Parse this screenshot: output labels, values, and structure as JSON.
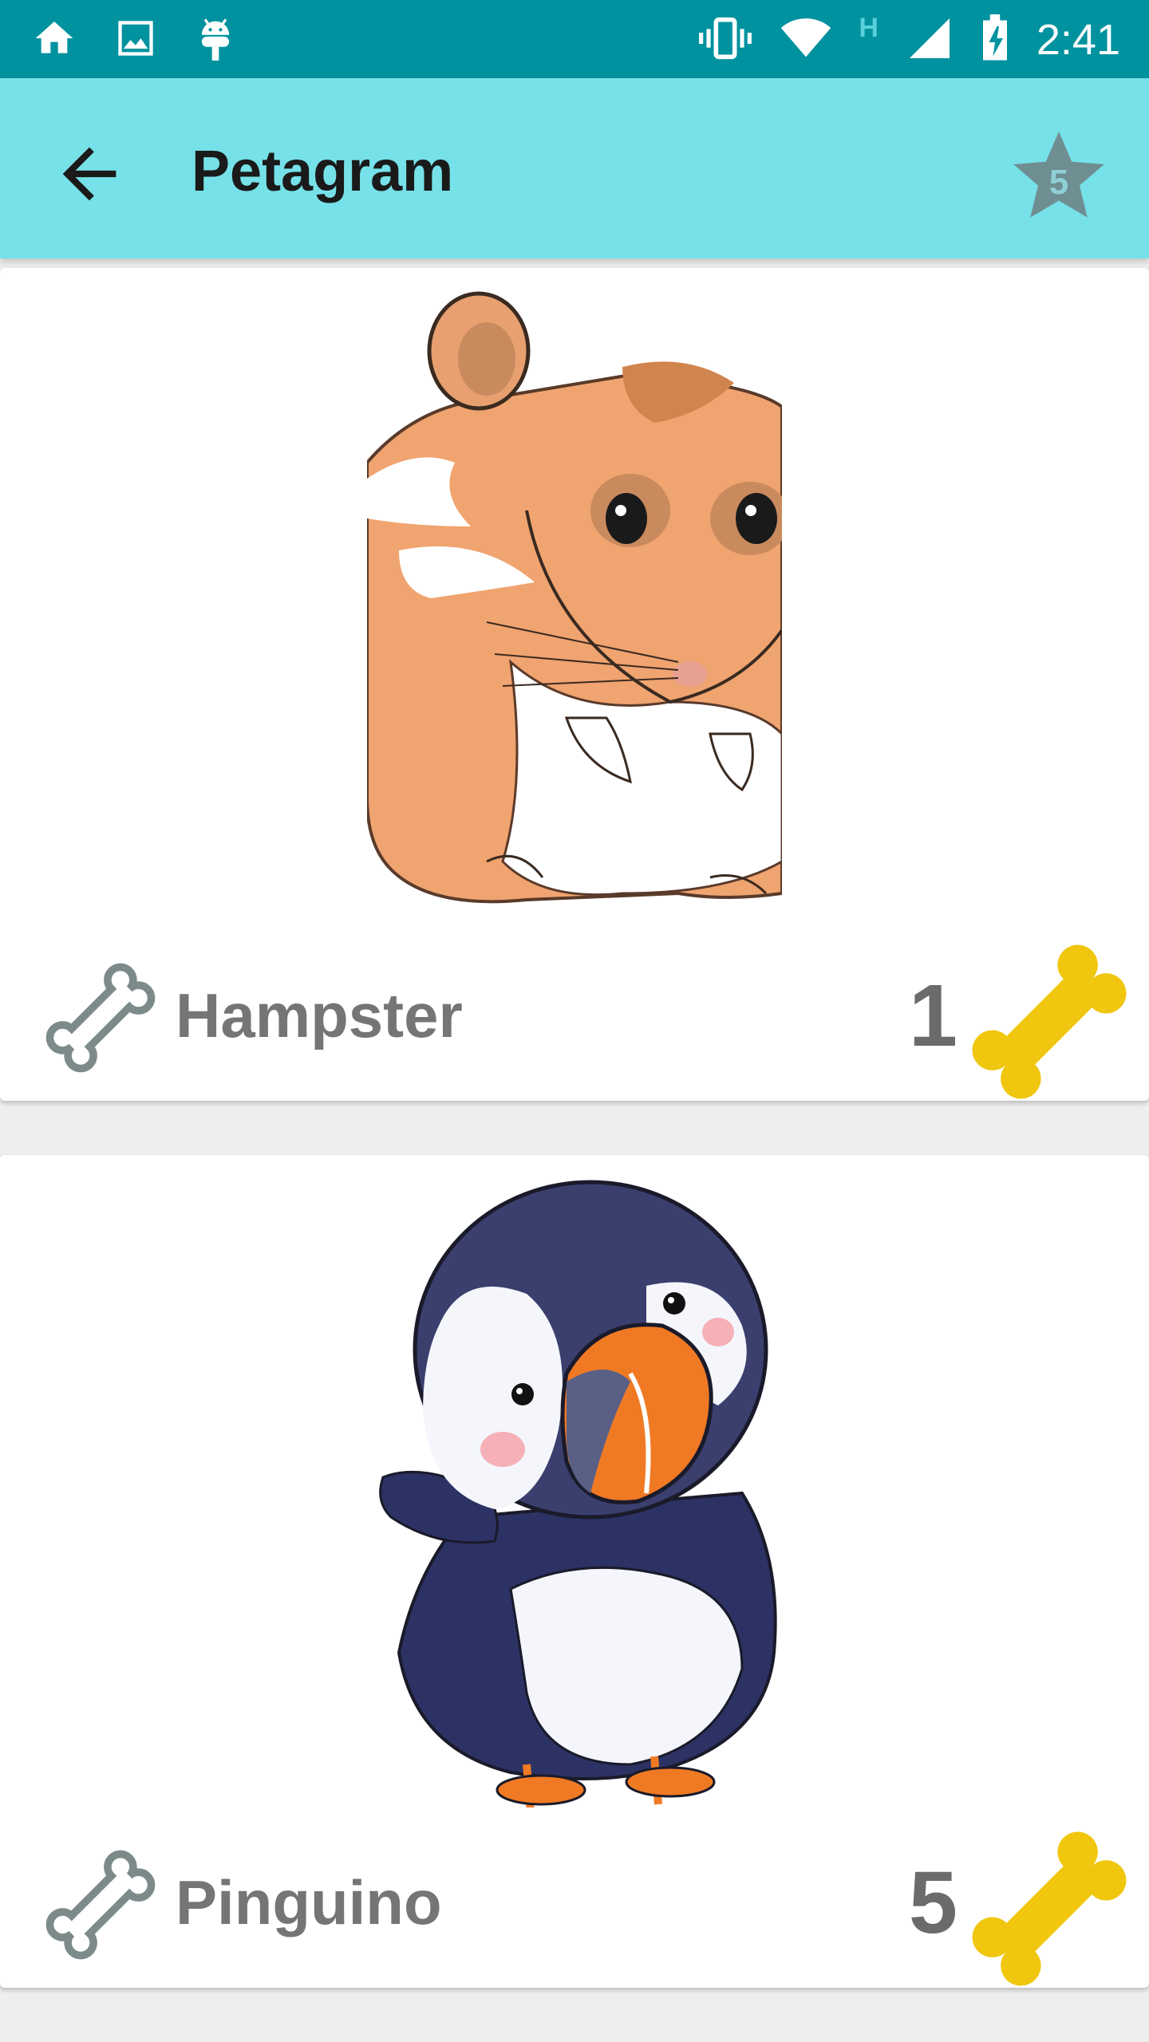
{
  "status_bar": {
    "time": "2:41",
    "network_type": "H",
    "icons": [
      "home-icon",
      "image-icon",
      "android-icon",
      "vibrate-icon",
      "wifi-icon",
      "signal-icon",
      "battery-charging-icon"
    ]
  },
  "app_bar": {
    "title": "Petagram",
    "back_icon": "arrow-back-icon",
    "favorites_count": "5",
    "favorites_icon": "star-icon"
  },
  "pets": [
    {
      "name": "Hampster",
      "likes": "1",
      "image": "hamster-illustration"
    },
    {
      "name": "Pinguino",
      "likes": "5",
      "image": "puffin-illustration"
    }
  ],
  "colors": {
    "status_bar": "#00929f",
    "app_bar": "#76e1e8",
    "bone_like": "#f0c60e",
    "bone_outline": "#7c8a8a",
    "text_secondary": "#757575"
  }
}
